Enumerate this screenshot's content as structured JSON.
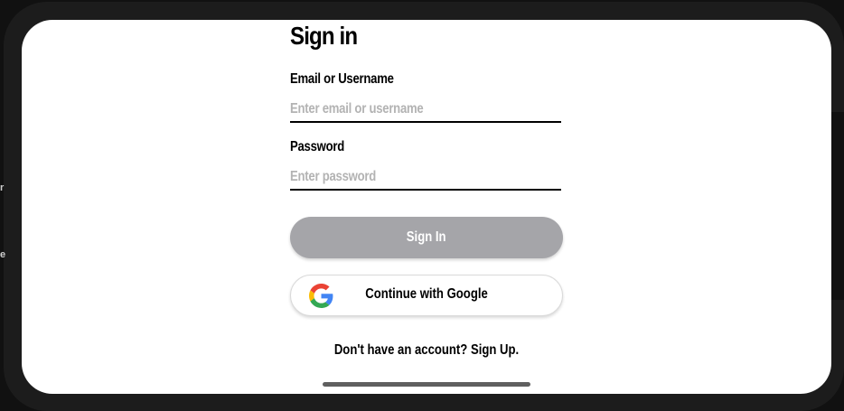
{
  "side": {
    "char_1": "r",
    "char_2": "e"
  },
  "screen": {
    "title": "Sign in",
    "email": {
      "label": "Email or Username",
      "placeholder": "Enter email or username",
      "value": ""
    },
    "password": {
      "label": "Password",
      "placeholder": "Enter password",
      "value": ""
    },
    "signin_button": "Sign In",
    "google_button": "Continue with Google",
    "signup_prompt": "Don't have an account?",
    "signup_link": "Sign Up."
  },
  "colors": {
    "signin_button_bg": "#a5a5a9",
    "device_frame": "#1c1c1c",
    "google_blue": "#4285F4",
    "google_red": "#EA4335",
    "google_yellow": "#FBBC05",
    "google_green": "#34A853"
  },
  "icons": {
    "google": "google-logo-icon"
  }
}
